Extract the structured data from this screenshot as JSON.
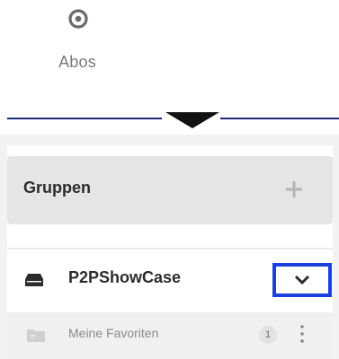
{
  "top_nav": {
    "abos_label": "Abos",
    "abos_icon": "eye-icon"
  },
  "groups": {
    "title": "Gruppen",
    "add_icon": "plus-icon",
    "items": [
      {
        "name": "P2PShowCase",
        "icon": "drive-icon",
        "expand_icon": "chevron-down-icon",
        "children": [
          {
            "label": "Meine Favoriten",
            "icon": "folder-icon",
            "count": "1",
            "menu_icon": "more-vertical-icon"
          }
        ]
      }
    ]
  },
  "colors": {
    "divider": "#1f2a73",
    "highlight_border": "#1a3fe0",
    "header_bg": "#e5e5e5"
  }
}
